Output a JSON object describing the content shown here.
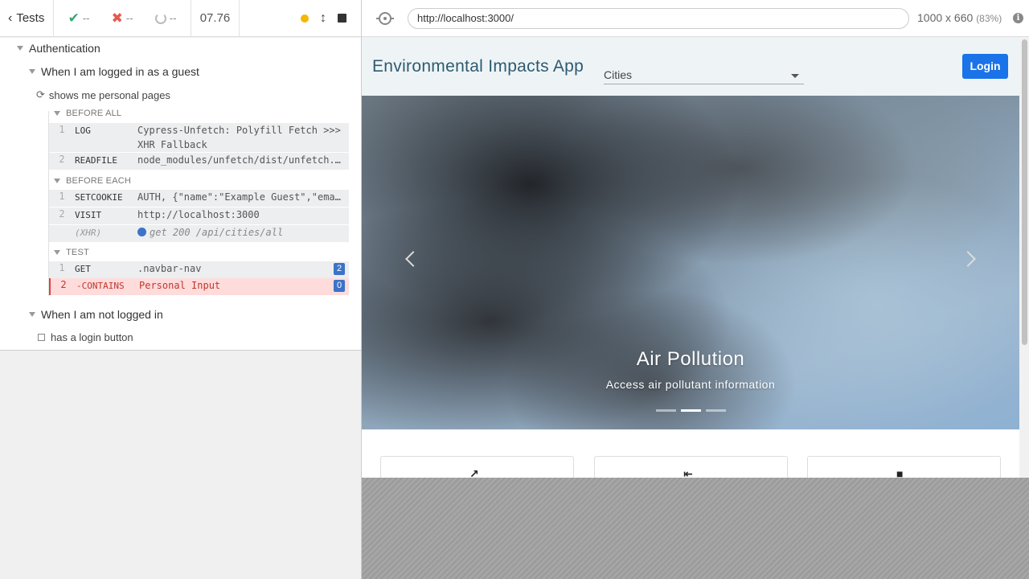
{
  "reporter": {
    "tests_label": "Tests",
    "passed": "--",
    "failed": "--",
    "pending": "--",
    "duration": "07.76",
    "suite": {
      "title": "Authentication",
      "contexts": [
        {
          "title": "When I am logged in as a guest",
          "test": {
            "title": "shows me personal pages",
            "hooks": [
              {
                "label": "BEFORE ALL",
                "commands": [
                  {
                    "num": "1",
                    "name": "LOG",
                    "message": "Cypress-Unfetch: Polyfill Fetch >>> XHR Fallback"
                  },
                  {
                    "num": "2",
                    "name": "READFILE",
                    "message": "node_modules/unfetch/dist/unfetch.umd.js"
                  }
                ]
              },
              {
                "label": "BEFORE EACH",
                "commands": [
                  {
                    "num": "1",
                    "name": "SETCOOKIE",
                    "message": "AUTH, {\"name\":\"Example Guest\",\"email\":\"guest@example.com\"}"
                  },
                  {
                    "num": "2",
                    "name": "VISIT",
                    "message": "http://localhost:3000"
                  },
                  {
                    "num": "",
                    "name": "(XHR)",
                    "message": "get 200 /api/cities/all"
                  }
                ]
              },
              {
                "label": "TEST",
                "commands": [
                  {
                    "num": "1",
                    "name": "GET",
                    "message": ".navbar-nav",
                    "badge": "2"
                  },
                  {
                    "num": "2",
                    "name": "-CONTAINS",
                    "message": "Personal Input",
                    "badge": "0"
                  }
                ]
              }
            ]
          }
        },
        {
          "title": "When I am not logged in",
          "test": {
            "title": "has a login button"
          }
        }
      ]
    }
  },
  "aut": {
    "url": "http://localhost:3000/",
    "viewport": "1000 x 660",
    "zoom": "(83%)",
    "info_icon_glyph": "i"
  },
  "app": {
    "brand": "Environmental Impacts App",
    "city_select": "Cities",
    "login_label": "Login",
    "hero": {
      "title": "Air Pollution",
      "subtitle": "Access air pollutant information",
      "slide_count": 3,
      "active_slide": 2
    },
    "card_icons": [
      "trend-up-icon",
      "arrow-left-icon",
      "folder-icon"
    ]
  },
  "colors": {
    "pass": "#3aa675",
    "fail": "#e45a4c",
    "brand": "#2e5a70",
    "login": "#1a73e8",
    "badge": "#3b73c8"
  }
}
